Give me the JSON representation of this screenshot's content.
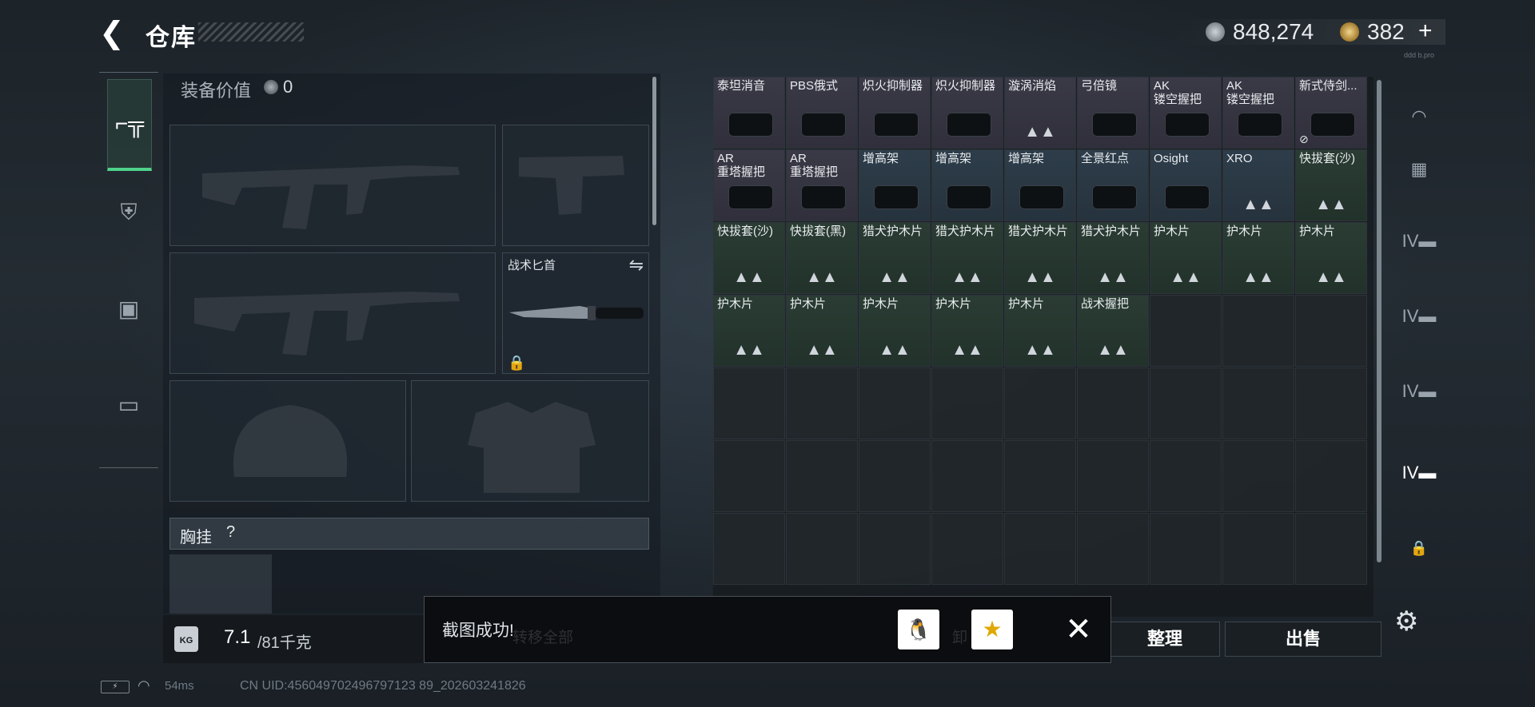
{
  "header": {
    "back_icon": "back-arrow-icon",
    "title": "仓库",
    "currency": {
      "silver": "848,274",
      "gold": "382",
      "plus": "+"
    },
    "version": "ddd b.pro"
  },
  "left_nav": {
    "items": [
      {
        "icon": "gun-icon",
        "glyph": "⌐╦",
        "active": true
      },
      {
        "icon": "armor-icon",
        "glyph": "⛨"
      },
      {
        "icon": "backpack-icon",
        "glyph": "▣"
      },
      {
        "icon": "case-icon",
        "glyph": "▭"
      }
    ]
  },
  "equipment": {
    "value_label": "装备价值",
    "value": "0",
    "knife": {
      "name": "战术匕首",
      "swap_icon": "swap-arrows-icon",
      "lock_icon": "lock-icon"
    },
    "chest": {
      "label": "胸挂",
      "help": "?"
    },
    "weight": {
      "icon_text": "KG",
      "current": "7.1",
      "max": "/81千克"
    }
  },
  "inventory": {
    "cells": [
      {
        "name": "泰坦消音",
        "color": "purple",
        "img": true
      },
      {
        "name": "PBS俄式",
        "color": "purple",
        "img": true
      },
      {
        "name": "炽火抑制器",
        "color": "purple",
        "img": true
      },
      {
        "name": "炽火抑制器",
        "color": "purple",
        "img": true
      },
      {
        "name": "漩涡消焰",
        "color": "purple",
        "icon": "▲▲"
      },
      {
        "name": "弓倍镜",
        "color": "purple",
        "img": true
      },
      {
        "name": "AK\n镂空握把",
        "color": "purple",
        "img": true
      },
      {
        "name": "AK\n镂空握把",
        "color": "purple",
        "img": true
      },
      {
        "name": "新式侍剑...",
        "color": "purple",
        "img": true,
        "badge": "⊘"
      },
      {
        "name": "AR\n重塔握把",
        "color": "purple",
        "img": true
      },
      {
        "name": "AR\n重塔握把",
        "color": "purple",
        "img": true
      },
      {
        "name": "增高架",
        "color": "blue",
        "img": true
      },
      {
        "name": "增高架",
        "color": "blue",
        "img": true
      },
      {
        "name": "增高架",
        "color": "blue",
        "img": true
      },
      {
        "name": "全景红点",
        "color": "blue",
        "img": true
      },
      {
        "name": "Osight",
        "color": "blue",
        "img": true
      },
      {
        "name": "XRO",
        "color": "blue",
        "icon": "▲▲"
      },
      {
        "name": "快拔套(沙)",
        "color": "green",
        "icon": "▲▲"
      },
      {
        "name": "快拔套(沙)",
        "color": "green",
        "icon": "▲▲"
      },
      {
        "name": "快拔套(黑)",
        "color": "green",
        "icon": "▲▲"
      },
      {
        "name": "猎犬护木片",
        "color": "green",
        "icon": "▲▲"
      },
      {
        "name": "猎犬护木片",
        "color": "green",
        "icon": "▲▲"
      },
      {
        "name": "猎犬护木片",
        "color": "green",
        "icon": "▲▲"
      },
      {
        "name": "猎犬护木片",
        "color": "green",
        "icon": "▲▲"
      },
      {
        "name": "护木片",
        "color": "green",
        "icon": "▲▲"
      },
      {
        "name": "护木片",
        "color": "green",
        "icon": "▲▲"
      },
      {
        "name": "护木片",
        "color": "green",
        "icon": "▲▲"
      },
      {
        "name": "护木片",
        "color": "green",
        "icon": "▲▲"
      },
      {
        "name": "护木片",
        "color": "green",
        "icon": "▲▲"
      },
      {
        "name": "护木片",
        "color": "green",
        "icon": "▲▲"
      },
      {
        "name": "护木片",
        "color": "green",
        "icon": "▲▲"
      },
      {
        "name": "护木片",
        "color": "green",
        "icon": "▲▲"
      },
      {
        "name": "战术握把",
        "color": "green",
        "icon": "▲▲"
      }
    ]
  },
  "right_nav": {
    "items": [
      {
        "icon": "helmet-nav-icon",
        "glyph": "◠"
      },
      {
        "icon": "weapon-category-icon",
        "glyph": "▦"
      },
      {
        "icon": "tier4-crate-icon",
        "glyph": "IV▬"
      },
      {
        "icon": "tier4-crate-icon",
        "glyph": "IV▬"
      },
      {
        "icon": "tier4-crate-icon",
        "glyph": "IV▬"
      },
      {
        "icon": "tier4-crate-active-icon",
        "glyph": "IV▬"
      },
      {
        "icon": "lock-icon",
        "glyph": "🔒"
      }
    ],
    "settings_icon": "gear-icon"
  },
  "buttons": {
    "sort": "整理",
    "sell": "出售"
  },
  "toast": {
    "message": "截图成功!",
    "under_text_1": "转移全部",
    "under_text_2": "卸",
    "share_icons": [
      "qq-share-icon",
      "qzone-share-icon"
    ],
    "close": "✕"
  },
  "status": {
    "battery": "⚡",
    "ping": "54ms",
    "uid": "CN UID:456049702496797123 89_202603241826"
  }
}
